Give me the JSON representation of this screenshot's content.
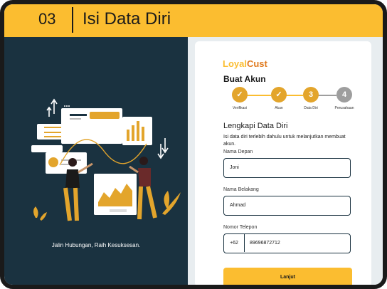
{
  "header": {
    "step_number": "03",
    "title": "Isi Data Diri"
  },
  "left_panel": {
    "tagline": "Jalin Hubungan, Raih Kesuksesan."
  },
  "form": {
    "logo": {
      "part1": "Loyal",
      "part2": "Cust"
    },
    "title": "Buat Akun",
    "steps": [
      {
        "mark": "✓",
        "label": "Verifikasi",
        "state": "done"
      },
      {
        "mark": "✓",
        "label": "Akun",
        "state": "done"
      },
      {
        "mark": "3",
        "label": "Data Diri",
        "state": "active"
      },
      {
        "mark": "4",
        "label": "Perusahaan",
        "state": "pending"
      }
    ],
    "section_title": "Lengkapi Data Diri",
    "description": "Isi data diri terlebih dahulu untuk melanjutkan membuat akun.",
    "first_name": {
      "label": "Nama Depan",
      "value": "Joni"
    },
    "last_name": {
      "label": "Nama Belakang",
      "value": "Ahmad"
    },
    "phone": {
      "label": "Nomor Telepon",
      "prefix": "+62",
      "value": "89696872712"
    },
    "submit_label": "Lanjut"
  },
  "colors": {
    "accent": "#fbbd30",
    "dark": "#1a3240",
    "pending": "#9e9e9e"
  }
}
